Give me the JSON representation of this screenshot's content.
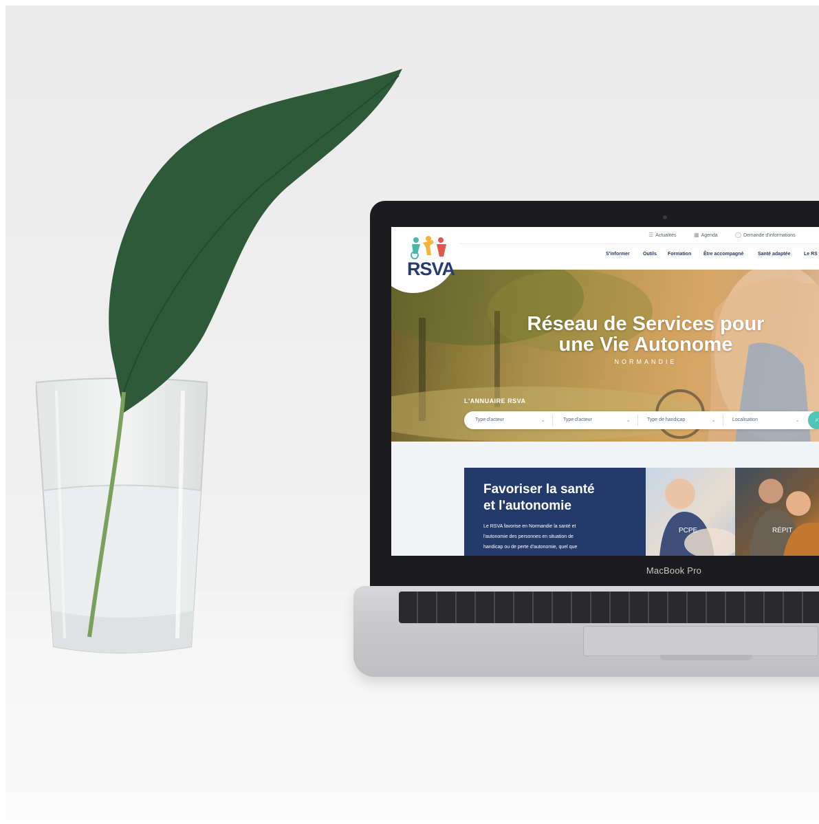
{
  "device": {
    "bezel_label": "MacBook Pro"
  },
  "utility_nav": [
    {
      "label": "Actualités",
      "icon": "list-icon"
    },
    {
      "label": "Agenda",
      "icon": "calendar-icon"
    },
    {
      "label": "Demande d'informations",
      "icon": "chat-bubble-icon"
    }
  ],
  "logo": {
    "text": "RSVA",
    "colors": [
      "#49b8a9",
      "#f2b33d",
      "#e2574c",
      "#263a73"
    ]
  },
  "main_nav": [
    "S'informer",
    "Outils",
    "Formation",
    "Être accompagné",
    "Santé adaptée",
    "Le RS"
  ],
  "hero": {
    "title_line1": "Réseau de Services pour",
    "title_line2": "une Vie Autonome",
    "subtitle": "NORMANDIE",
    "directory_label": "L'ANNUAIRE RSVA"
  },
  "search": {
    "selects": [
      "Type d'acteur",
      "Type d'acteur",
      "Type de handicap",
      "Localisation"
    ],
    "button_icon": "search-icon",
    "button_color": "#4fc5b5"
  },
  "feature": {
    "title_line1": "Favoriser la santé",
    "title_line2": "et l'autonomie",
    "text_line1": "Le RSVA favorise en Normandie la santé et",
    "text_line2": "l'autonomie des personnes en situation de",
    "text_line3": "handicap ou de perte d'autonomie, quel que",
    "background": "#233a6b"
  },
  "cards": [
    "PCPE",
    "RÉPIT"
  ]
}
